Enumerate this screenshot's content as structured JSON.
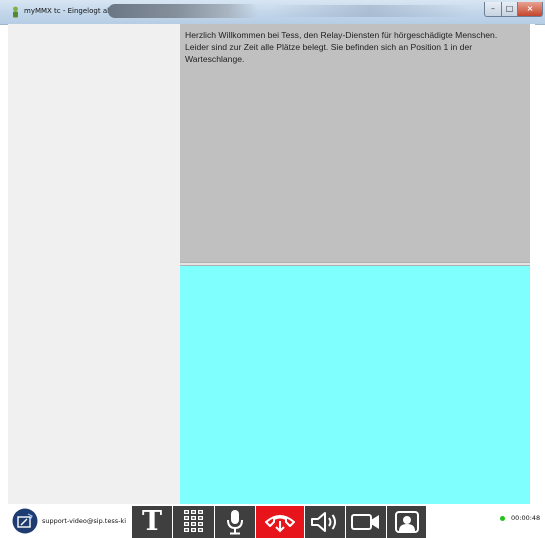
{
  "window": {
    "title": "myMMX tc - Eingelogt als",
    "buttons": {
      "minimize": "–",
      "maximize": "□",
      "close": "×"
    }
  },
  "message": {
    "text": "Herzlich Willkommen bei Tess, den Relay-Diensten für hörgeschädigte Menschen. Leider sind zur Zeit alle Plätze belegt. Sie befinden sich an Position 1 in der Warteschlange."
  },
  "panels": {
    "message_bg": "#c0c0c0",
    "input_bg": "#80ffff",
    "sidebar_bg": "#f0f0f0"
  },
  "bottom_bar": {
    "account": "support-video@sip.tess-ki",
    "text_button": "T",
    "status_color": "#22c41c",
    "timer": "00:00:48",
    "hangup_color": "#e8141b",
    "icons": [
      "logo-icon",
      "text-mode-icon",
      "dialpad-icon",
      "microphone-icon",
      "hangup-icon",
      "speaker-icon",
      "camera-icon",
      "self-view-icon"
    ]
  }
}
